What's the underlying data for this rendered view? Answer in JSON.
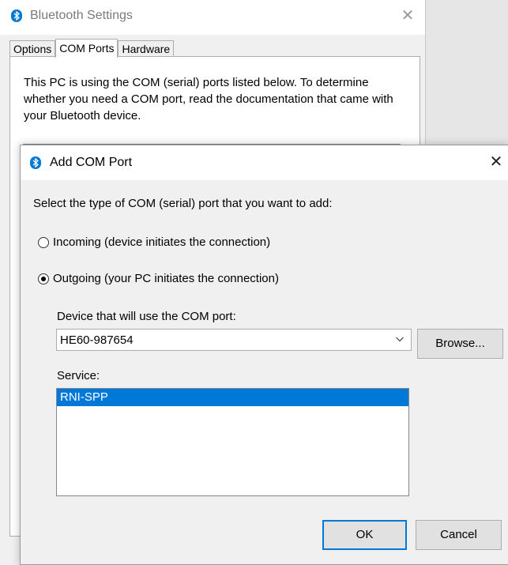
{
  "bluetooth_settings": {
    "title": "Bluetooth Settings",
    "tabs": [
      {
        "label": "Options"
      },
      {
        "label": "COM Ports"
      },
      {
        "label": "Hardware"
      }
    ],
    "active_tab": "COM Ports",
    "description": "This PC is using the COM (serial) ports listed below. To determine whether you need a COM port, read the documentation that came with your Bluetooth device."
  },
  "add_com_port": {
    "title": "Add COM Port",
    "prompt": "Select the type of COM (serial) port that you want to add:",
    "options": [
      {
        "label": "Incoming (device initiates the connection)",
        "selected": false
      },
      {
        "label": "Outgoing (your PC initiates the connection)",
        "selected": true
      }
    ],
    "device_label": "Device that will use the COM port:",
    "device_value": "HE60-987654",
    "browse_label": "Browse...",
    "service_label": "Service:",
    "services": [
      {
        "label": "RNI-SPP",
        "selected": true
      }
    ],
    "ok_label": "OK",
    "cancel_label": "Cancel"
  },
  "icons": {
    "app_icon": "bluetooth-icon",
    "close": "close-icon",
    "dropdown": "chevron-down-icon"
  },
  "colors": {
    "accent": "#0078d7",
    "selection": "#0078d7",
    "dialog_background": "#f0f0f0"
  }
}
